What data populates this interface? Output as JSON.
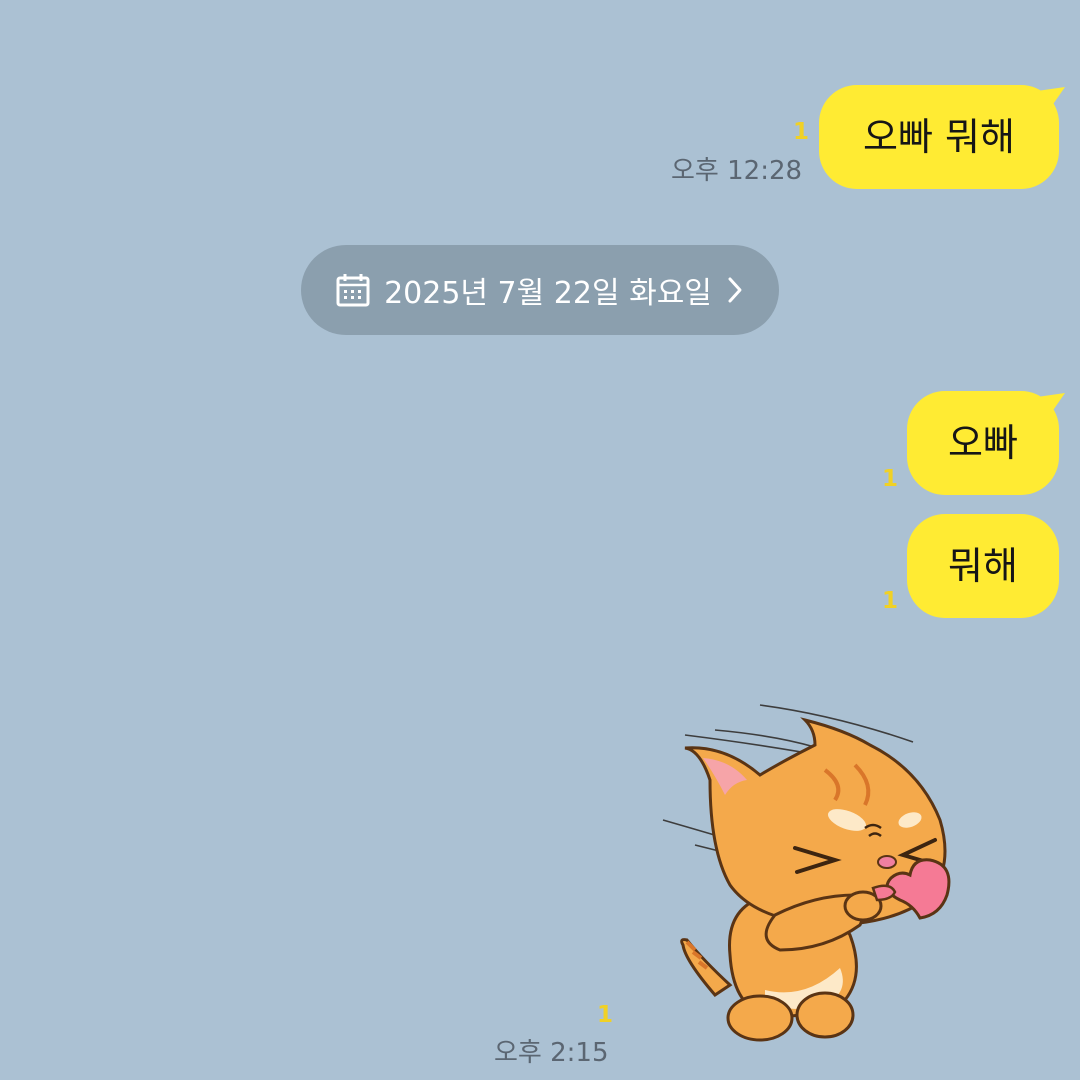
{
  "colors": {
    "background": "#abc1d3",
    "bubble": "#ffeb33",
    "unread": "#f0d125",
    "timestamp": "#5b6672",
    "date_pill": "#8b9fae"
  },
  "messages": [
    {
      "text": "오빠 뭐해",
      "unread": "1",
      "time": "오후 12:28"
    },
    {
      "text": "오빠",
      "unread": "1"
    },
    {
      "text": "뭐해",
      "unread": "1"
    }
  ],
  "date_divider": {
    "icon": "calendar-icon",
    "label": "2025년 7월 22일 화요일",
    "chevron": "chevron-right-icon"
  },
  "sticker": {
    "description_icon": "cat-blowing-heart-sticker",
    "unread": "1",
    "time": "오후 2:15"
  }
}
